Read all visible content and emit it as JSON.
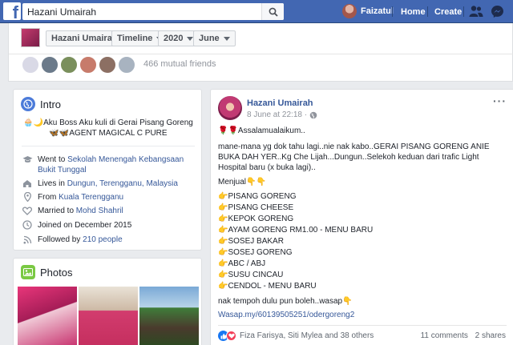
{
  "topbar": {
    "search_value": "Hazani Umairah",
    "user_name": "Faizatul",
    "home": "Home",
    "create": "Create"
  },
  "profile_strip": {
    "name_crumb": "Hazani Umairah",
    "timeline_crumb": "Timeline",
    "year_crumb": "2020",
    "month_crumb": "June",
    "mutual_friends": "466 mutual friends"
  },
  "intro": {
    "title": "Intro",
    "bio_line1": "Aku Boss Aku kuli di Gerai Pisang Goreng",
    "bio_line2": "AGENT MAGICAL C PURE",
    "items": [
      {
        "prefix": "Went to ",
        "link": "Sekolah Menengah Kebangsaan Bukit Tunggal",
        "suffix": ""
      },
      {
        "prefix": "Lives in ",
        "link": "Dungun, Terengganu, Malaysia",
        "suffix": ""
      },
      {
        "prefix": "From ",
        "link": "Kuala Terengganu",
        "suffix": ""
      },
      {
        "prefix": "Married to ",
        "link": "Mohd Shahril",
        "suffix": ""
      },
      {
        "prefix": "Joined on December 2015",
        "link": "",
        "suffix": ""
      },
      {
        "prefix": "Followed by ",
        "link": "210 people",
        "suffix": ""
      }
    ]
  },
  "photos": {
    "title": "Photos"
  },
  "post": {
    "author": "Hazani Umairah",
    "time": "8 June at 22:18 ·",
    "greeting": "Assalamualaikum..",
    "body": "mane-mana yg dok tahu lagi..nie nak kabo..GERAI PISANG GORENG ANIE BUKA DAH YER..Kg Che Lijah...Dungun..Selekoh keduan dari trafic Light Hospital baru (x buka lagi)..",
    "menu_title": "Menjual",
    "menu": [
      "PISANG GORENG",
      "PISANG CHEESE",
      "KEPOK GORENG",
      "AYAM GORENG RM1.00 - MENU BARU",
      "SOSEJ BAKAR",
      "SOSEJ GORENG",
      "ABC / ABJ",
      "SUSU CINCAU",
      "CENDOL - MENU BARU"
    ],
    "closing": "nak tempoh dulu pun boleh..wasap",
    "link": "Wasap.my/60139505251/odergoreng2",
    "reactions": "Fiza Farisya, Siti Mylea and 38 others",
    "comments": "11 comments",
    "shares": "2 shares"
  }
}
